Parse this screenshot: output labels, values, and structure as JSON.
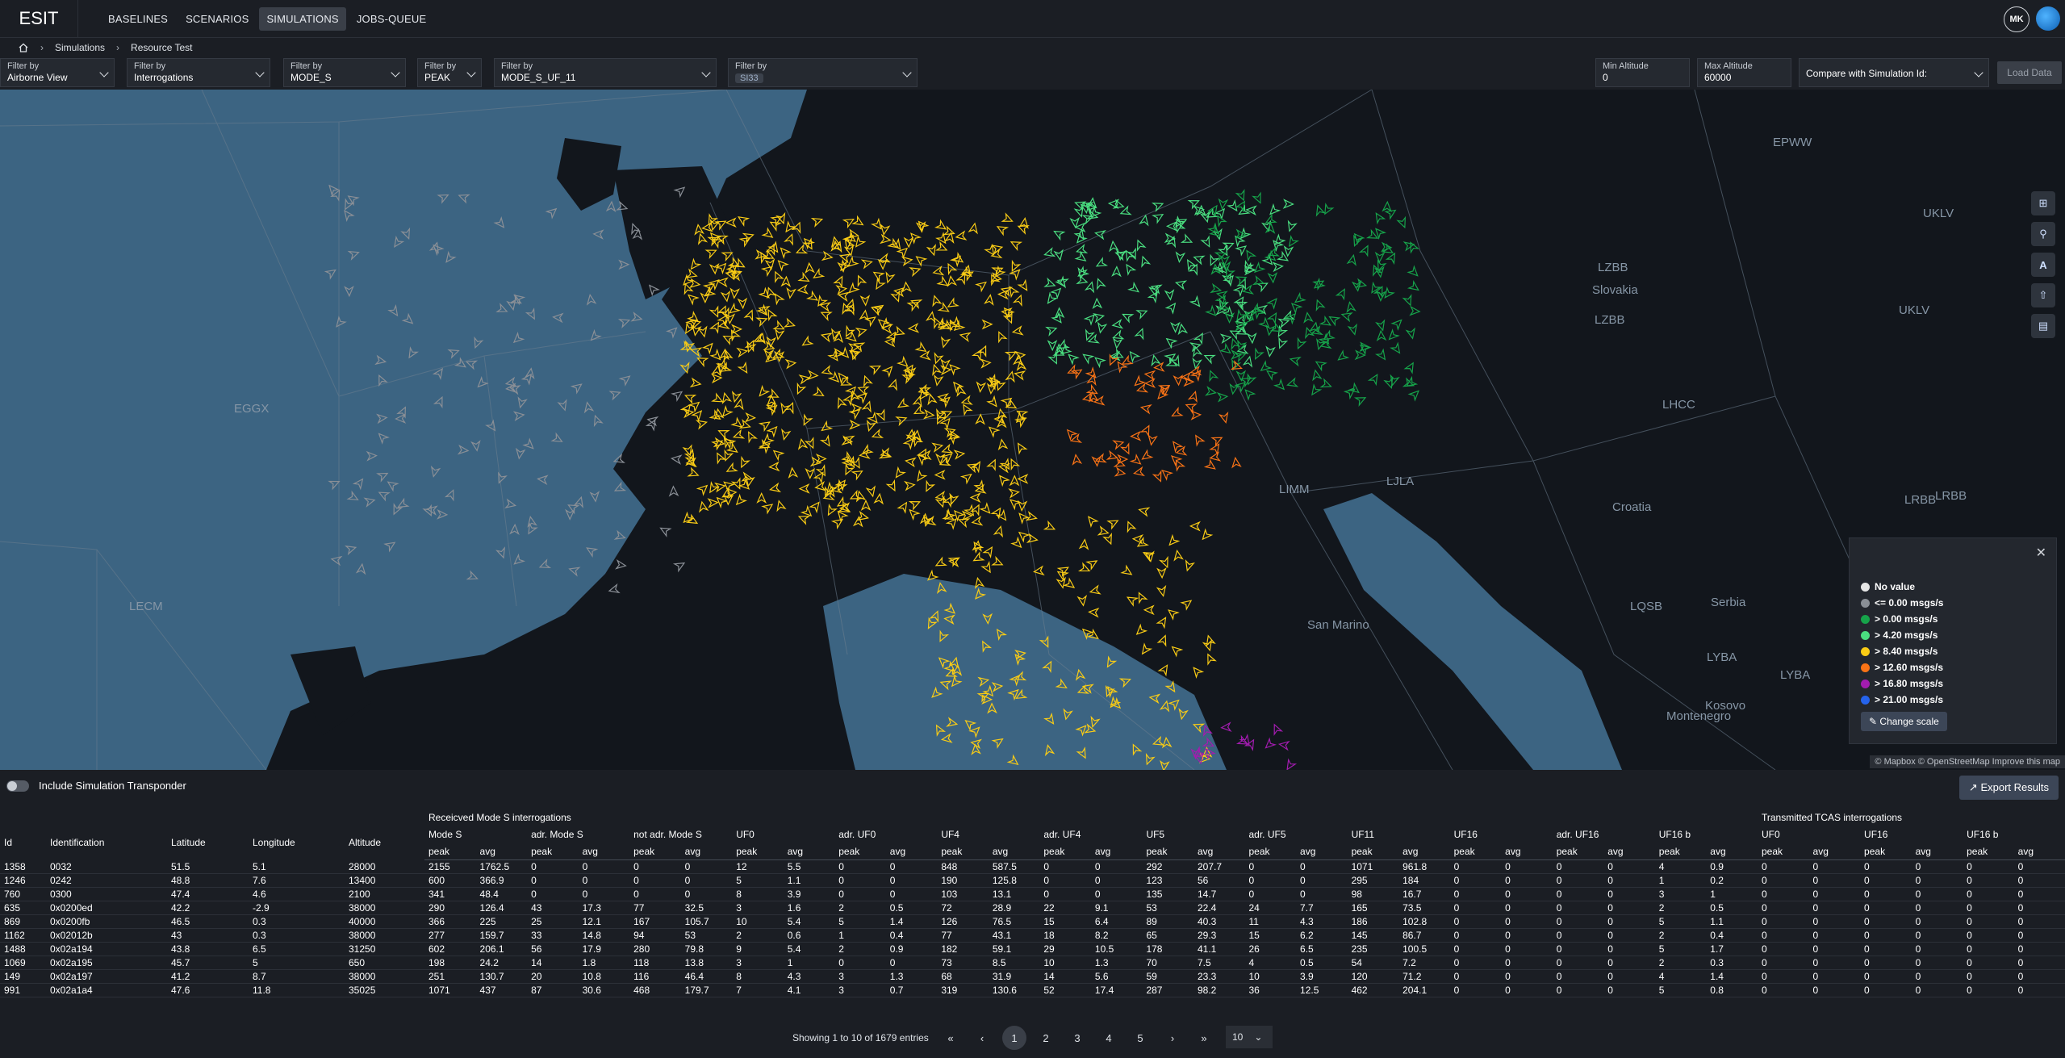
{
  "app": {
    "brand": "ESIT",
    "user_initials": "MK"
  },
  "nav": [
    {
      "label": "BASELINES"
    },
    {
      "label": "SCENARIOS"
    },
    {
      "label": "SIMULATIONS",
      "active": true
    },
    {
      "label": "JOBS-QUEUE"
    }
  ],
  "breadcrumb": {
    "level1": "Simulations",
    "level2": "Resource Test"
  },
  "filters": [
    {
      "label": "Filter by",
      "value": "Airborne View"
    },
    {
      "label": "Filter by",
      "value": "Interrogations"
    },
    {
      "label": "Filter by",
      "value": "MODE_S"
    },
    {
      "label": "Filter by",
      "value": "PEAK"
    },
    {
      "label": "Filter by",
      "value": "MODE_S_UF_11"
    },
    {
      "label": "Filter by",
      "value": "SI33"
    }
  ],
  "altitude": {
    "min_label": "Min Altitude",
    "min_value": "0",
    "max_label": "Max Altitude",
    "max_value": "60000"
  },
  "compare": {
    "label": "Compare with Simulation Id:"
  },
  "load_button": "Load Data",
  "map": {
    "labels": [
      "EGGX",
      "LECM",
      "LIMM",
      "LJLA",
      "LZBB",
      "LZBB",
      "LHCC",
      "LRBB",
      "LRBB",
      "LQSB",
      "LYBA",
      "LYBA",
      "UKLV",
      "UKLV",
      "EPWW",
      "Slovakia",
      "Croatia",
      "Serbia",
      "Kosovo",
      "San Marino",
      "Montenegro"
    ],
    "tools": [
      "layers-icon",
      "pin-icon",
      "text-icon",
      "share-icon",
      "map-icon"
    ],
    "mapbox_logo": "mapbox",
    "attribution": "© Mapbox © OpenStreetMap Improve this map"
  },
  "legend": {
    "items": [
      {
        "label": "No value",
        "color": "#e6e6e6"
      },
      {
        "label": "<= 0.00 msgs/s",
        "color": "#8a8f96"
      },
      {
        "label": "> 0.00 msgs/s",
        "color": "#16a34a"
      },
      {
        "label": "> 4.20 msgs/s",
        "color": "#4ade80"
      },
      {
        "label": "> 8.40 msgs/s",
        "color": "#facc15"
      },
      {
        "label": "> 12.60 msgs/s",
        "color": "#f97316"
      },
      {
        "label": "> 16.80 msgs/s",
        "color": "#a21caf"
      },
      {
        "label": "> 21.00 msgs/s",
        "color": "#2563eb"
      }
    ],
    "change_scale": "Change scale"
  },
  "toggle_label": "Include Simulation Transponder",
  "export_label": "Export Results",
  "table": {
    "group_headers": {
      "received": "Receicved Mode S interrogations",
      "transmitted": "Transmitted TCAS interrogations"
    },
    "columns": [
      "Id",
      "Identification",
      "Latitude",
      "Longitude",
      "Altitude",
      "Mode S",
      "adr. Mode S",
      "not adr. Mode S",
      "UF0",
      "adr. UF0",
      "UF4",
      "adr. UF4",
      "UF5",
      "adr. UF5",
      "UF11",
      "UF16",
      "adr. UF16",
      "UF16 b",
      "UF0",
      "UF16",
      "UF16 b"
    ],
    "sub": {
      "peak": "peak",
      "avg": "avg"
    },
    "rows": [
      [
        "1358",
        "0032",
        "51.5",
        "5.1",
        "28000",
        "2155",
        "1762.5",
        "0",
        "0",
        "0",
        "0",
        "12",
        "5.5",
        "0",
        "0",
        "848",
        "587.5",
        "0",
        "0",
        "292",
        "207.7",
        "0",
        "0",
        "1071",
        "961.8",
        "0",
        "0",
        "0",
        "0",
        "4",
        "0.9",
        "0",
        "0",
        "0",
        "0",
        "0",
        "0"
      ],
      [
        "1246",
        "0242",
        "48.8",
        "7.6",
        "13400",
        "600",
        "366.9",
        "0",
        "0",
        "0",
        "0",
        "5",
        "1.1",
        "0",
        "0",
        "190",
        "125.8",
        "0",
        "0",
        "123",
        "56",
        "0",
        "0",
        "295",
        "184",
        "0",
        "0",
        "0",
        "0",
        "1",
        "0.2",
        "0",
        "0",
        "0",
        "0",
        "0",
        "0"
      ],
      [
        "760",
        "0300",
        "47.4",
        "4.6",
        "2100",
        "341",
        "48.4",
        "0",
        "0",
        "0",
        "0",
        "8",
        "3.9",
        "0",
        "0",
        "103",
        "13.1",
        "0",
        "0",
        "135",
        "14.7",
        "0",
        "0",
        "98",
        "16.7",
        "0",
        "0",
        "0",
        "0",
        "3",
        "1",
        "0",
        "0",
        "0",
        "0",
        "0",
        "0"
      ],
      [
        "635",
        "0x0200ed",
        "42.2",
        "-2.9",
        "38000",
        "290",
        "126.4",
        "43",
        "17.3",
        "77",
        "32.5",
        "3",
        "1.6",
        "2",
        "0.5",
        "72",
        "28.9",
        "22",
        "9.1",
        "53",
        "22.4",
        "24",
        "7.7",
        "165",
        "73.5",
        "0",
        "0",
        "0",
        "0",
        "2",
        "0.5",
        "0",
        "0",
        "0",
        "0",
        "0",
        "0"
      ],
      [
        "869",
        "0x0200fb",
        "46.5",
        "0.3",
        "40000",
        "366",
        "225",
        "25",
        "12.1",
        "167",
        "105.7",
        "10",
        "5.4",
        "5",
        "1.4",
        "126",
        "76.5",
        "15",
        "6.4",
        "89",
        "40.3",
        "11",
        "4.3",
        "186",
        "102.8",
        "0",
        "0",
        "0",
        "0",
        "5",
        "1.1",
        "0",
        "0",
        "0",
        "0",
        "0",
        "0"
      ],
      [
        "1162",
        "0x02012b",
        "43",
        "0.3",
        "38000",
        "277",
        "159.7",
        "33",
        "14.8",
        "94",
        "53",
        "2",
        "0.6",
        "1",
        "0.4",
        "77",
        "43.1",
        "18",
        "8.2",
        "65",
        "29.3",
        "15",
        "6.2",
        "145",
        "86.7",
        "0",
        "0",
        "0",
        "0",
        "2",
        "0.4",
        "0",
        "0",
        "0",
        "0",
        "0",
        "0"
      ],
      [
        "1488",
        "0x02a194",
        "43.8",
        "6.5",
        "31250",
        "602",
        "206.1",
        "56",
        "17.9",
        "280",
        "79.8",
        "9",
        "5.4",
        "2",
        "0.9",
        "182",
        "59.1",
        "29",
        "10.5",
        "178",
        "41.1",
        "26",
        "6.5",
        "235",
        "100.5",
        "0",
        "0",
        "0",
        "0",
        "5",
        "1.7",
        "0",
        "0",
        "0",
        "0",
        "0",
        "0"
      ],
      [
        "1069",
        "0x02a195",
        "45.7",
        "5",
        "650",
        "198",
        "24.2",
        "14",
        "1.8",
        "118",
        "13.8",
        "3",
        "1",
        "0",
        "0",
        "73",
        "8.5",
        "10",
        "1.3",
        "70",
        "7.5",
        "4",
        "0.5",
        "54",
        "7.2",
        "0",
        "0",
        "0",
        "0",
        "2",
        "0.3",
        "0",
        "0",
        "0",
        "0",
        "0",
        "0"
      ],
      [
        "149",
        "0x02a197",
        "41.2",
        "8.7",
        "38000",
        "251",
        "130.7",
        "20",
        "10.8",
        "116",
        "46.4",
        "8",
        "4.3",
        "3",
        "1.3",
        "68",
        "31.9",
        "14",
        "5.6",
        "59",
        "23.3",
        "10",
        "3.9",
        "120",
        "71.2",
        "0",
        "0",
        "0",
        "0",
        "4",
        "1.4",
        "0",
        "0",
        "0",
        "0",
        "0",
        "0"
      ],
      [
        "991",
        "0x02a1a4",
        "47.6",
        "11.8",
        "35025",
        "1071",
        "437",
        "87",
        "30.6",
        "468",
        "179.7",
        "7",
        "4.1",
        "3",
        "0.7",
        "319",
        "130.6",
        "52",
        "17.4",
        "287",
        "98.2",
        "36",
        "12.5",
        "462",
        "204.1",
        "0",
        "0",
        "0",
        "0",
        "5",
        "0.8",
        "0",
        "0",
        "0",
        "0",
        "0",
        "0"
      ]
    ]
  },
  "pagination": {
    "info": "Showing 1 to 10 of 1679 entries",
    "pages": [
      "1",
      "2",
      "3",
      "4",
      "5"
    ],
    "page_size": "10"
  }
}
